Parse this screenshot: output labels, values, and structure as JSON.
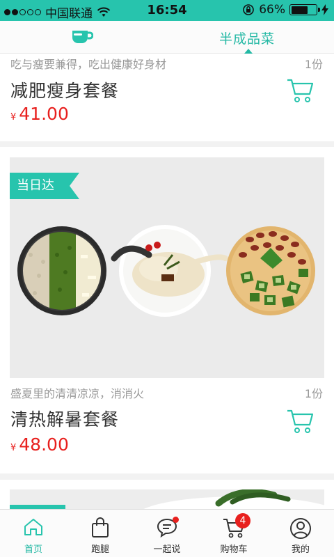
{
  "status_bar": {
    "carrier": "中国联通",
    "time": "16:54",
    "battery_percent": "66%",
    "battery_level": 0.66,
    "signal_icon": "signal-dots-icon",
    "wifi_icon": "wifi-icon",
    "rotation_lock_icon": "rotation-lock-icon",
    "charging_icon": "charging-bolt-icon"
  },
  "header": {
    "left_icon": "cup-icon",
    "right_tab_label": "半成品菜"
  },
  "products": [
    {
      "subtitle": "吃与瘦要兼得，吃出健康好身材",
      "quantity": "1份",
      "name": "减肥瘦身套餐",
      "currency": "¥",
      "price": "41.00"
    },
    {
      "tag": "当日达",
      "subtitle": "盛夏里的清清凉凉，消消火",
      "quantity": "1份",
      "name": "清热解暑套餐",
      "currency": "¥",
      "price": "48.00"
    }
  ],
  "bottom_nav": {
    "items": [
      {
        "label": "首页",
        "icon": "home-icon"
      },
      {
        "label": "跑腿",
        "icon": "bag-icon"
      },
      {
        "label": "一起说",
        "icon": "chat-icon"
      },
      {
        "label": "购物车",
        "icon": "cart-icon",
        "badge": "4"
      },
      {
        "label": "我的",
        "icon": "user-icon"
      }
    ]
  },
  "colors": {
    "accent": "#27c4ad",
    "price": "#e8201e"
  }
}
